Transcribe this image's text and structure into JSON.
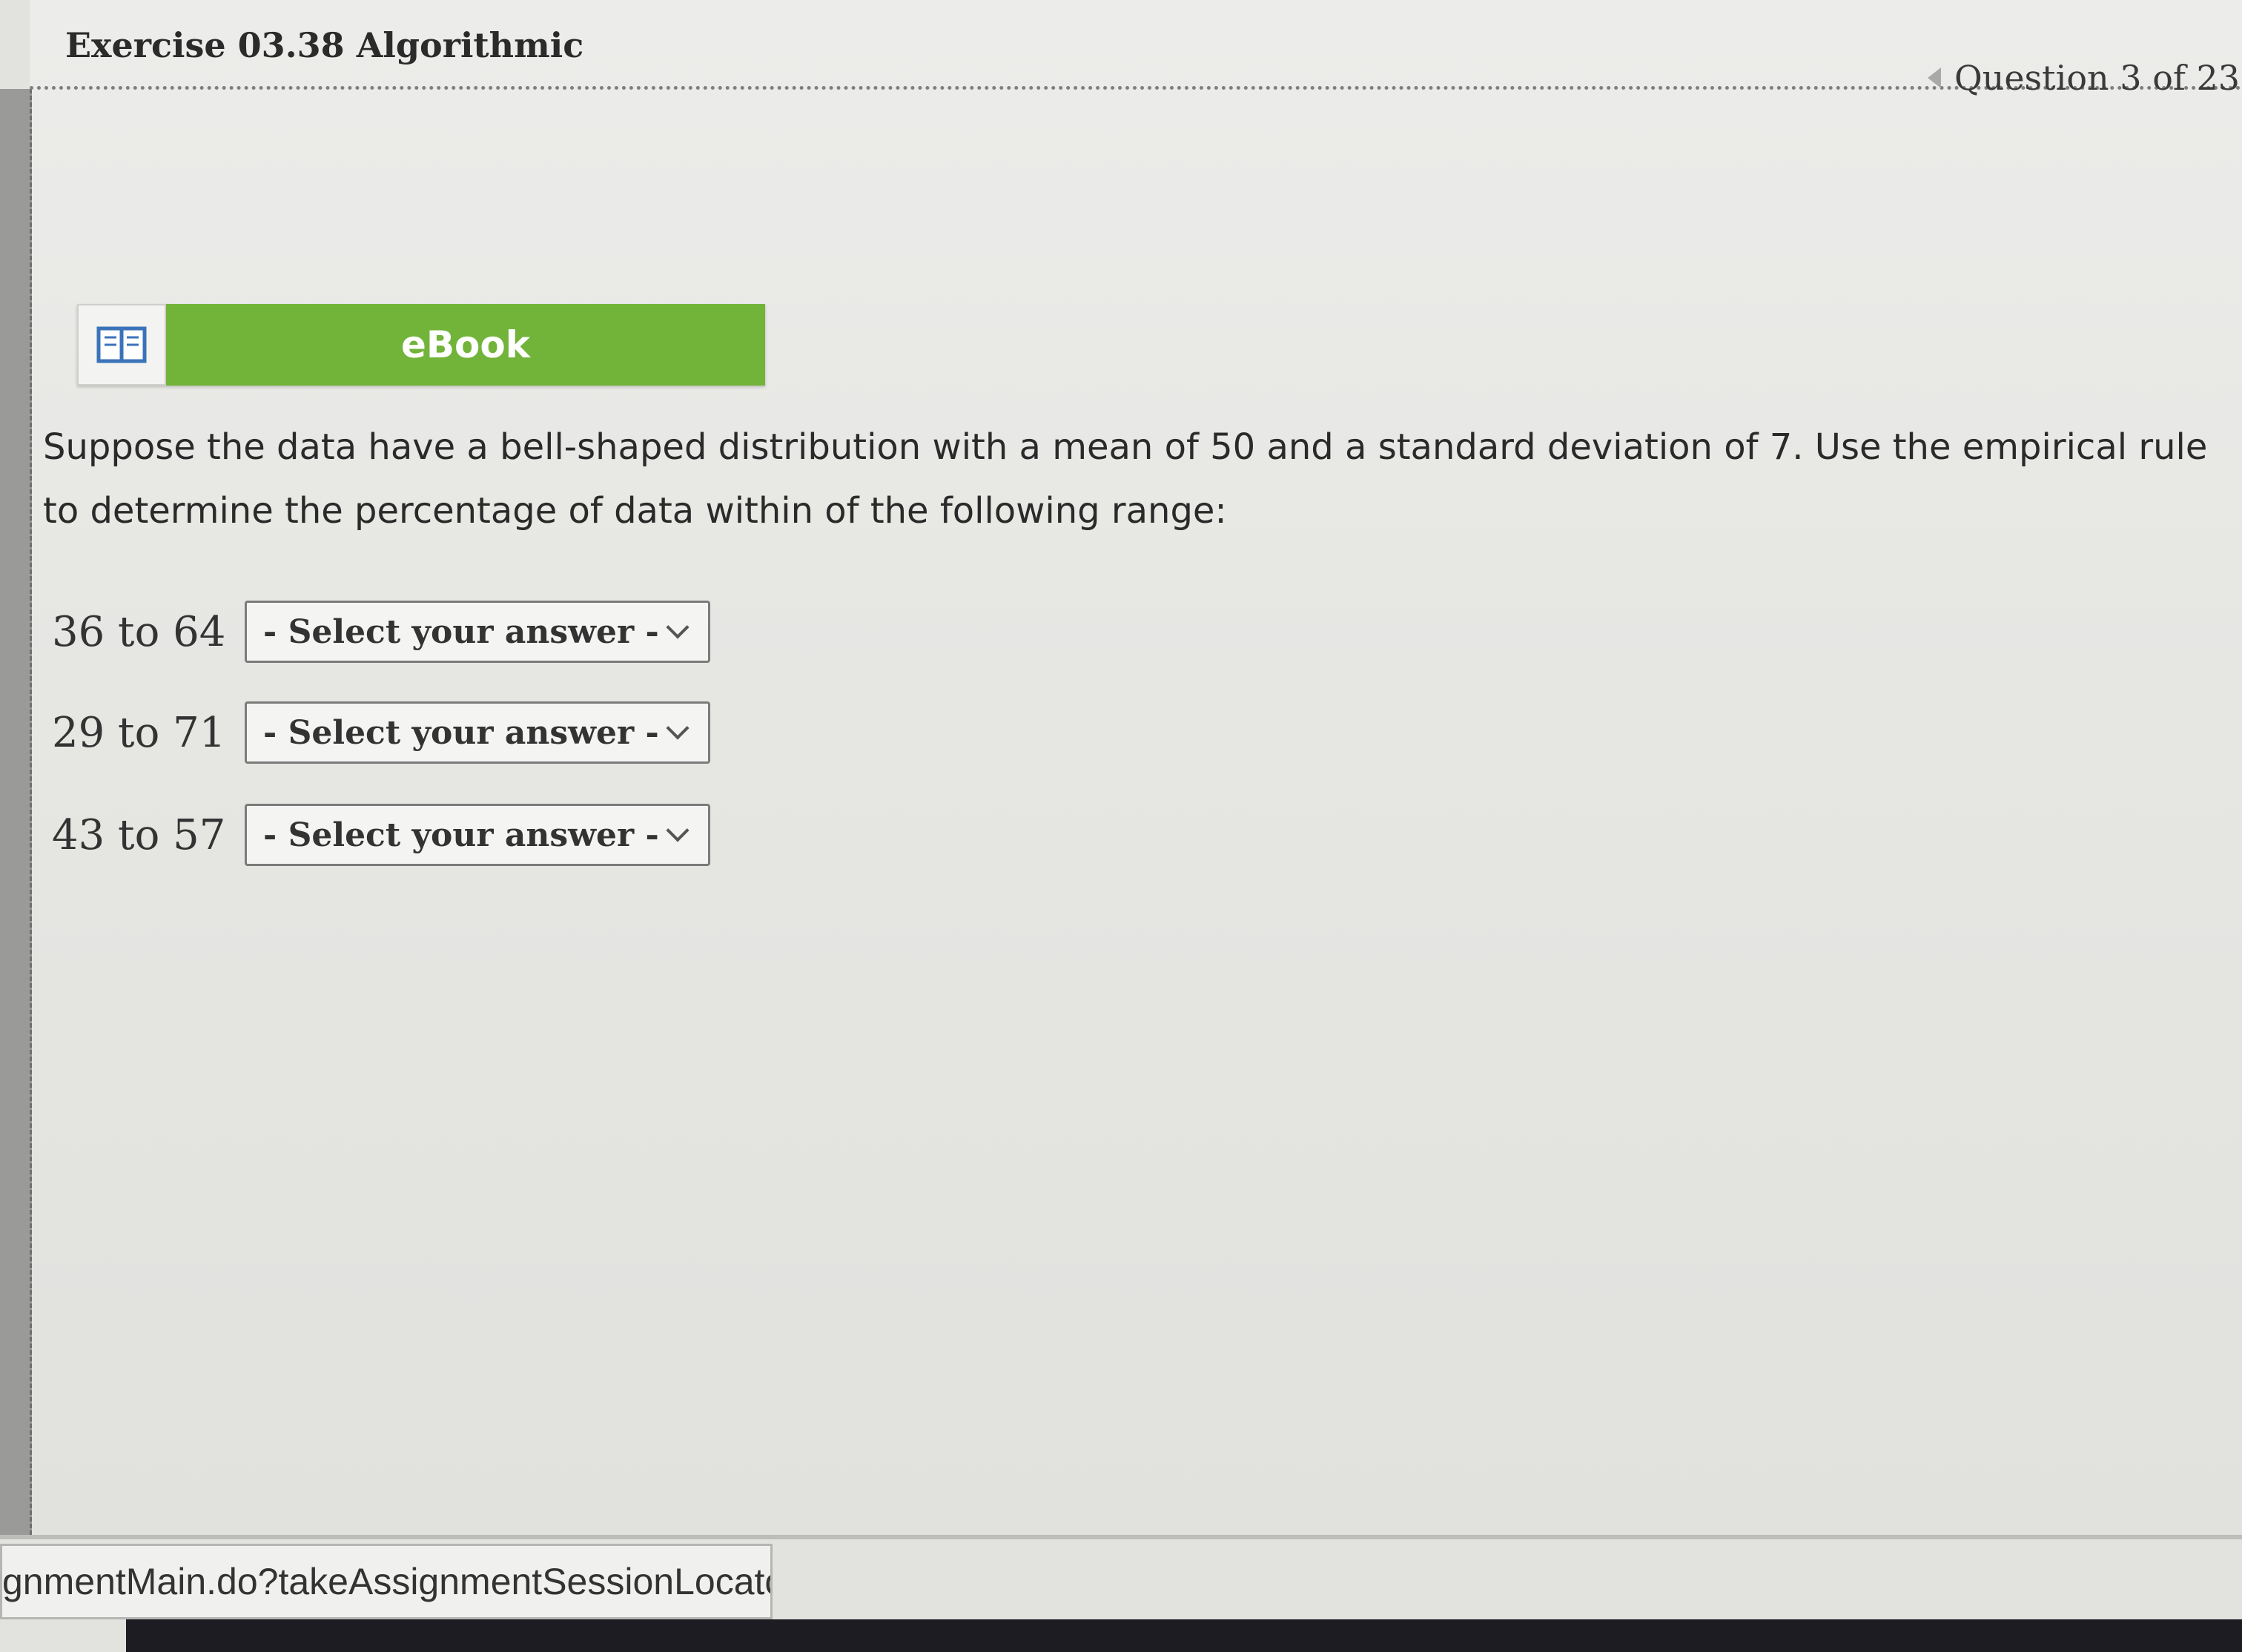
{
  "exercise": {
    "title": "Exercise 03.38 Algorithmic"
  },
  "nav": {
    "question_label": "Question 3 of 23",
    "prev_icon": "caret-left-icon"
  },
  "ebook": {
    "label": "eBook",
    "icon": "book-icon",
    "color": "#72b43a"
  },
  "prompt": {
    "text": "Suppose the data have a bell-shaped distribution with a mean of 50 and a standard deviation of 7. Use the empirical rule to determine the percentage of data within of the following range:"
  },
  "questions": [
    {
      "range": "36 to 64",
      "select_value": "- Select your answer -"
    },
    {
      "range": "29 to 71",
      "select_value": "- Select your answer -"
    },
    {
      "range": "43 to 57",
      "select_value": "- Select your answer -"
    }
  ],
  "statusbar": {
    "url": "gnmentMain.do?takeAssignmentSessionLocato"
  }
}
